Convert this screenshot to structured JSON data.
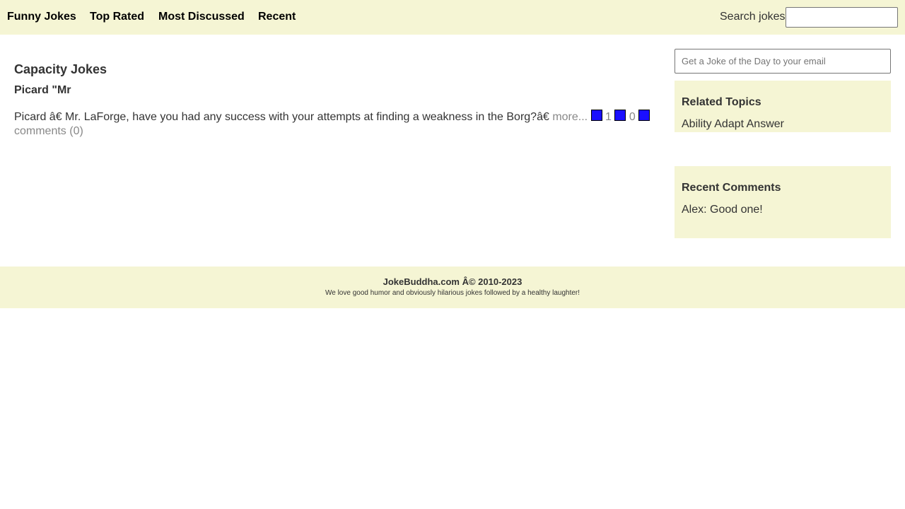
{
  "nav": {
    "items": [
      {
        "label": "Funny Jokes"
      },
      {
        "label": "Top Rated"
      },
      {
        "label": "Most Discussed"
      },
      {
        "label": "Recent"
      }
    ],
    "search_label": "Search jokes",
    "search_value": ""
  },
  "main": {
    "title": "Capacity Jokes",
    "joke": {
      "title": "Picard \"Mr",
      "body": "Picard â€ Mr. LaForge, have you had any success with your attempts at finding a weakness in the Borg?â€",
      "more_label": "more...",
      "up_count": "1",
      "down_count": "0",
      "comments_label": "comments (0)"
    }
  },
  "sidebar": {
    "jod_placeholder": "Get a Joke of the Day to your email",
    "related": {
      "heading": "Related Topics",
      "topics": "Ability Adapt Answer"
    },
    "recent_comments": {
      "heading": "Recent Comments",
      "comment": "Alex: Good one!"
    }
  },
  "footer": {
    "copyright": "JokeBuddha.com Â© 2010-2023",
    "tagline": "We love good humor and obviously hilarious jokes followed by a healthy laughter!"
  },
  "colors": {
    "bar_background": "#f5f5d4",
    "vote_square": "#1a0fff",
    "muted_text": "#888888"
  }
}
